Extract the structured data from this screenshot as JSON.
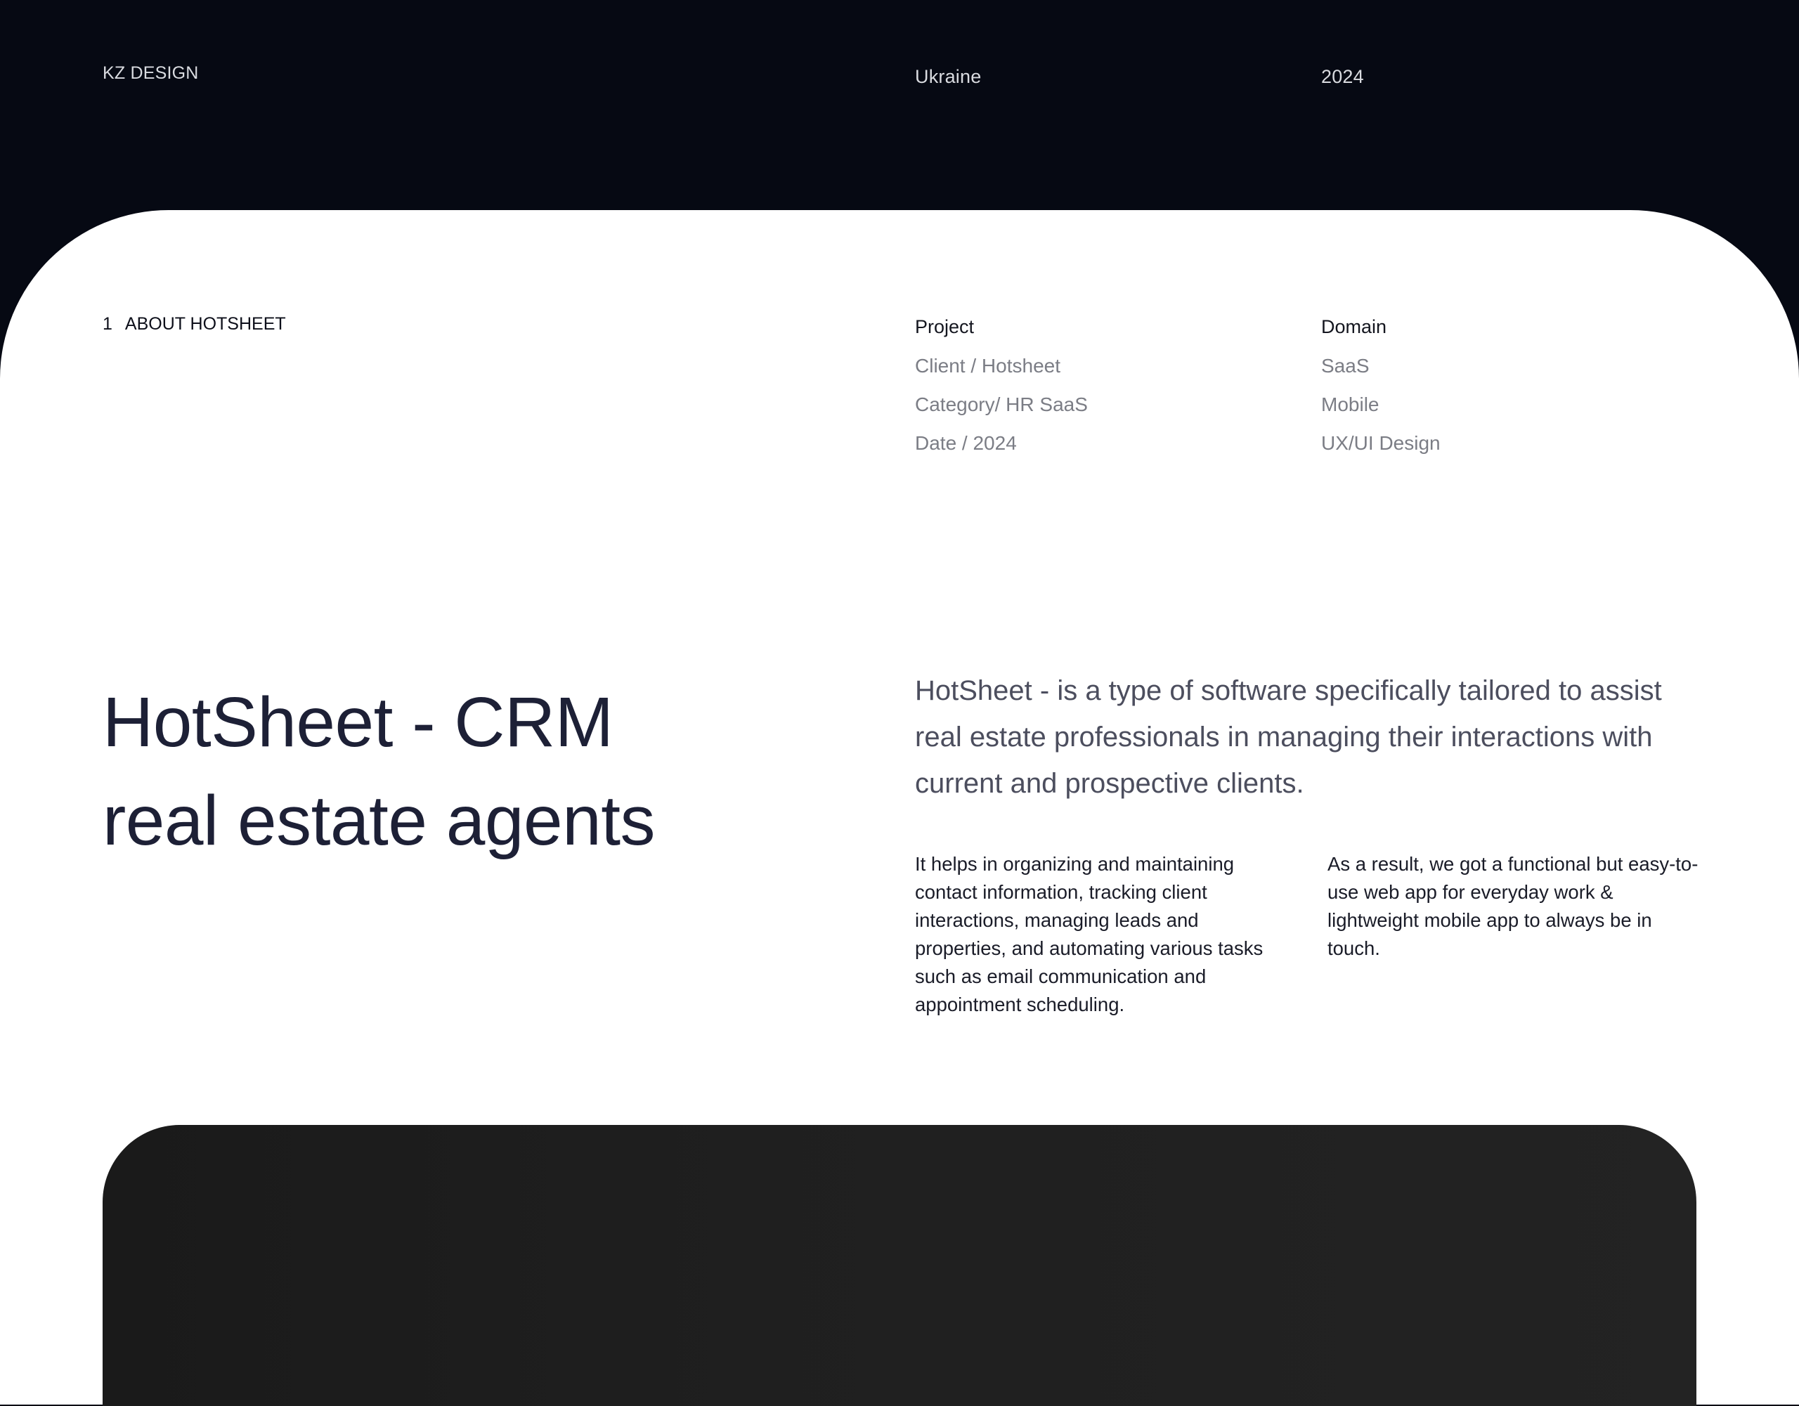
{
  "header": {
    "brand": "KZ DESIGN",
    "country": "Ukraine",
    "year": "2024"
  },
  "section": {
    "number": "1",
    "label": "ABOUT HOTSHEET"
  },
  "project": {
    "heading": "Project",
    "items": [
      "Client / Hotsheet",
      "Category/ HR SaaS",
      "Date / 2024"
    ]
  },
  "domain": {
    "heading": "Domain",
    "items": [
      "SaaS",
      "Mobile",
      "UX/UI Design"
    ]
  },
  "hero": {
    "title_line1": "HotSheet - CRM",
    "title_line2": "real estate agents"
  },
  "description": {
    "lead": "HotSheet - is a type of software specifically tailored to assist real estate professionals in managing their interactions with current and prospective clients.",
    "body_left": "It helps in organizing and maintaining contact information, tracking client interactions, managing leads and properties, and automating various tasks such as email communication and appointment scheduling.",
    "body_right": "As a result, we got a functional but easy-to-use web app for everyday work & lightweight mobile app to always be in touch."
  },
  "colors": {
    "header_bg": "#060913",
    "card_bg": "#ffffff",
    "title": "#1d2036",
    "muted": "#7b7d85",
    "showcase_bg": "#1f1f1f"
  }
}
